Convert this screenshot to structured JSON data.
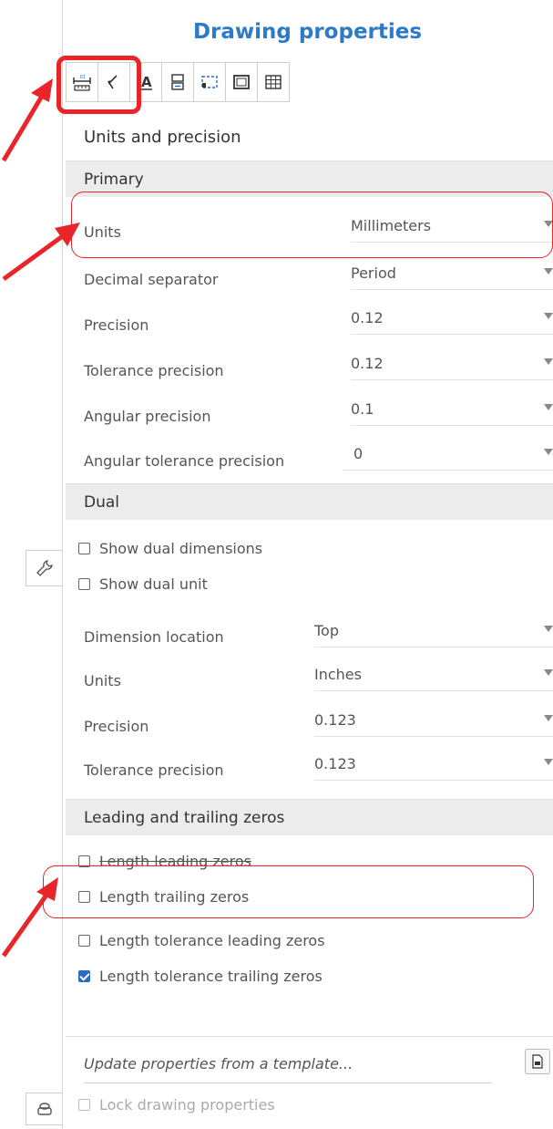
{
  "panel": {
    "title": "Drawing properties",
    "subtitle": "Units and precision"
  },
  "toolbar": {
    "buttons": [
      {
        "name": "units-precision-tab",
        "icon": "dimension-ruler-icon"
      },
      {
        "name": "arrows-tab",
        "icon": "arrow-curve-icon"
      },
      {
        "name": "text-tab",
        "icon": "text-a-icon"
      },
      {
        "name": "layout-tab",
        "icon": "stacked-boxes-icon"
      },
      {
        "name": "frame-tab",
        "icon": "dashed-frame-icon"
      },
      {
        "name": "border-tab",
        "icon": "border-box-icon"
      },
      {
        "name": "table-tab",
        "icon": "table-grid-icon"
      }
    ]
  },
  "primary": {
    "heading": "Primary",
    "rows": [
      {
        "label": "Units",
        "value": "Millimeters"
      },
      {
        "label": "Decimal separator",
        "value": "Period"
      },
      {
        "label": "Precision",
        "value": "0.12"
      },
      {
        "label": "Tolerance precision",
        "value": "0.12"
      },
      {
        "label": "Angular precision",
        "value": "0.1"
      },
      {
        "label": "Angular tolerance precision",
        "value": "0"
      }
    ]
  },
  "dual": {
    "heading": "Dual",
    "checks": [
      {
        "label": "Show dual dimensions",
        "checked": false
      },
      {
        "label": "Show dual unit",
        "checked": false
      }
    ],
    "rows": [
      {
        "label": "Dimension location",
        "value": "Top"
      },
      {
        "label": "Units",
        "value": "Inches"
      },
      {
        "label": "Precision",
        "value": "0.123"
      },
      {
        "label": "Tolerance precision",
        "value": "0.123"
      }
    ]
  },
  "zeros": {
    "heading": "Leading and trailing zeros",
    "checks": [
      {
        "label": "Length leading zeros",
        "checked": false
      },
      {
        "label": "Length trailing zeros",
        "checked": false
      },
      {
        "label": "Length tolerance leading zeros",
        "checked": false
      },
      {
        "label": "Length tolerance trailing zeros",
        "checked": true
      }
    ]
  },
  "footer": {
    "template_placeholder": "Update properties from a template...",
    "lock_label": "Lock drawing properties"
  },
  "colors": {
    "title": "#2d7bc8",
    "annotation": "#e8262a",
    "checked": "#2b6cc4"
  }
}
